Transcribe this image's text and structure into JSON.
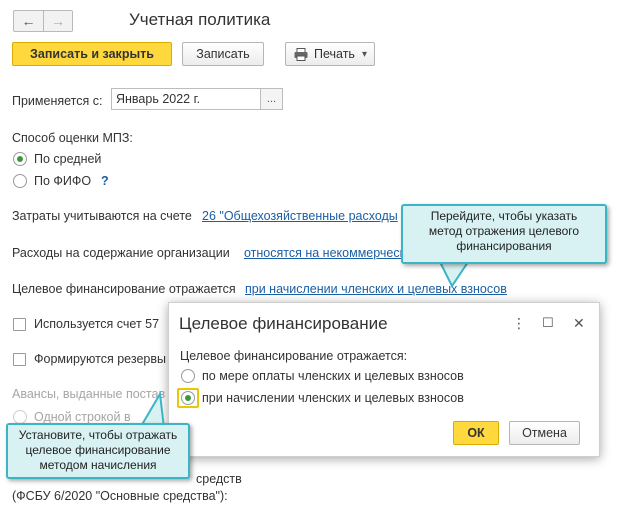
{
  "header": {
    "title": "Учетная политика",
    "back_icon": "←",
    "forward_icon": "→"
  },
  "toolbar": {
    "save_close_label": "Записать и закрыть",
    "save_label": "Записать",
    "print_label": "Печать",
    "print_icon": "printer-icon",
    "dropdown_icon": "▾"
  },
  "form": {
    "applies_label": "Применяется с:",
    "applies_value": "Январь 2022 г.",
    "picker_label": "...",
    "mpz_label": "Способ оценки МПЗ:",
    "mpz_option_average": "По средней",
    "mpz_option_fifo": "По ФИФО",
    "help_mark": "?",
    "costs_label": "Затраты учитываются на счете",
    "costs_link": "26 \"Общехозяйственные расходы",
    "org_expenses_label": "Расходы на содержание организации",
    "org_expenses_link": "относятся на некоммерческ",
    "target_financing_label": "Целевое финансирование отражается",
    "target_financing_link": "при начислении членских и целевых взносов",
    "account57_label": "Используется счет 57",
    "reserves_label": "Формируются резервы",
    "advances_label": "Авансы, выданные постав",
    "advances_option": "Одной строкой в",
    "fixed_assets_tail": "средств",
    "fsbu_label": "(ФСБУ 6/2020 \"Основные средства\"):"
  },
  "dialog": {
    "title": "Целевое финансирование",
    "prompt": "Целевое финансирование отражается:",
    "option_payment": "по мере оплаты членских и целевых взносов",
    "option_accrual": "при начислении членских и целевых взносов",
    "ok_label": "ОК",
    "cancel_label": "Отмена",
    "menu_icon": "⋮",
    "maximize_icon": "☐",
    "close_icon": "✕"
  },
  "callouts": {
    "top_lines": [
      "Перейдите, чтобы указать",
      "метод отражения целевого",
      "финансирования"
    ],
    "bottom_lines": [
      "Установите, чтобы отражать",
      "целевое финансирование",
      "методом начисления"
    ]
  },
  "colors": {
    "accent": "#ffd83d",
    "link": "#1a5fa5",
    "radio_on": "#3a9a3a",
    "callout_bg": "#d8f2f4",
    "callout_border": "#3bb5c3"
  }
}
